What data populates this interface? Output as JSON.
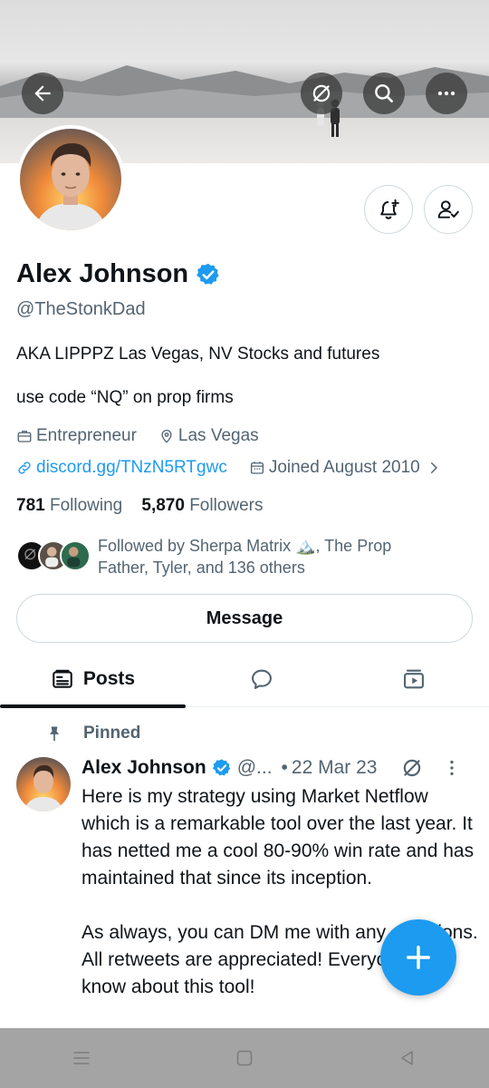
{
  "profile": {
    "name": "Alex Johnson",
    "handle": "@TheStonkDad",
    "bio_line1": "AKA LIPPPZ Las Vegas, NV Stocks and futures",
    "bio_line2": "use code “NQ” on prop firms",
    "occupation": "Entrepreneur",
    "location": "Las Vegas",
    "website": "discord.gg/TNzN5RTgwc",
    "joined": "Joined August 2010",
    "following_count": "781",
    "following_label": "Following",
    "followers_count": "5,870",
    "followers_label": "Followers",
    "followed_by_line1": "Followed by Sherpa Matrix 🏔️, The Prop",
    "followed_by_line2": "Father, Tyler, and 136 others",
    "message_label": "Message"
  },
  "tabs": {
    "posts_label": "Posts",
    "replies_icon": "speech-bubble-icon",
    "media_icon": "media-icon"
  },
  "pinned_post": {
    "pinned_label": "Pinned",
    "author_name": "Alex Johnson",
    "author_handle": "@...",
    "date": "22 Mar 23",
    "body": "Here is my strategy using Market Netflow which is a remarkable tool over the last year. It has netted me a cool 80-90% win rate and has maintained that since its inception.\n\nAs always, you can DM me with any questions. All retweets are appreciated! Everyone must know about this tool!"
  },
  "colors": {
    "accent": "#1d9bf0",
    "text_primary": "#0f1419",
    "text_secondary": "#536471",
    "border": "#cfd9de",
    "system_nav": "#a4a4a4"
  },
  "icons": {
    "back": "arrow-left-icon",
    "grok": "grok-icon",
    "search": "search-icon",
    "more": "more-horizontal-icon",
    "notify": "bell-plus-icon",
    "following": "person-check-icon",
    "verified": "verified-badge-icon",
    "compose": "plus-icon"
  }
}
